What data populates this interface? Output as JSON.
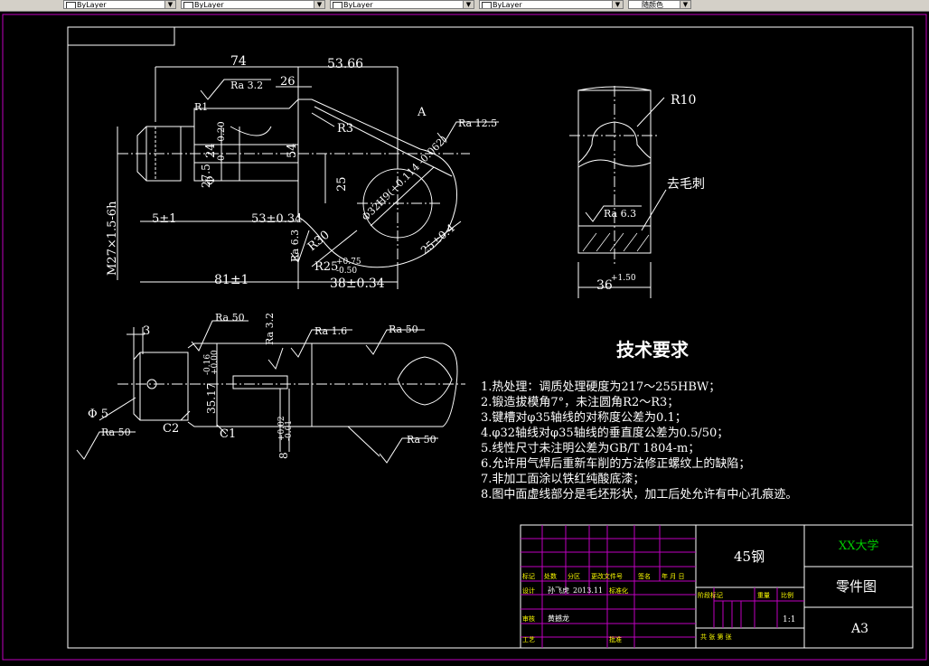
{
  "toolbar": {
    "combo1": "ByLayer",
    "combo2": "ByLayer",
    "combo3": "ByLayer",
    "combo4": "随颜色"
  },
  "top_view": {
    "dim_74": "74",
    "dim_5366": "53.66",
    "dim_26": "26",
    "ra_32": "Ra 3.2",
    "r1": "R1",
    "r3": "R3",
    "dim_24": "24",
    "dim_phi": "Φ",
    "dim_0": "0",
    "dim_020": "-0.20",
    "dim_275": "27.5",
    "dim_54": "54",
    "dim_25": "25",
    "label_a": "A",
    "ra_125": "Ra 12.5",
    "thread": "M27×1.5-6h",
    "dim_5pm1": "5±1",
    "dim_53pm034": "53±0.34",
    "r30": "R30",
    "ra_63": "Ra 6.3",
    "r25": "R25",
    "r25_tol_up": "+0.75",
    "r25_tol_dn": "-0.50",
    "dim_81pm1": "81±1",
    "dim_38pm034": "38±0.34",
    "dim_25pm04": "25±0.4",
    "hole_label": "Φ32H9(+0.114 -0.062)"
  },
  "right_view": {
    "r10": "R10",
    "deburr": "去毛刺",
    "ra_63": "Ra 6.3",
    "dim_36": "36",
    "tol": "+1.50"
  },
  "front_view": {
    "dim_3": "3",
    "ra_50a": "Ra 50",
    "ra_32": "Ra 3.2",
    "ra_16": "Ra 1.6",
    "ra_50b": "Ra 50",
    "dim_3517": "35.17",
    "tol_a": "-0.16",
    "tol_b": "+0.00",
    "dim_phi5": "Φ 5",
    "c2": "C2",
    "c1": "C1",
    "ra_50c": "Ra 50",
    "ra_50d": "Ra 50",
    "dim_8": "8",
    "tol_8a": "+0.02",
    "tol_8b": "-0.01"
  },
  "tech": {
    "title": "技术要求",
    "items": [
      "1.热处理：调质处理硬度为217～255HBW；",
      "2.锻造拔模角7°，未注圆角R2～R3；",
      "3.键槽对φ35轴线的对称度公差为0.1；",
      "4.φ32轴线对φ35轴线的垂直度公差为0.5/50；",
      "5.线性尺寸未注明公差为GB/T 1804-m；",
      "6.允许用气焊后重新车削的方法修正螺纹上的缺陷；",
      "7.非加工面涂以铁红纯酸底漆；",
      "8.图中面虚线部分是毛坯形状，加工后处允许有中心孔痕迹。"
    ]
  },
  "titleblock": {
    "material": "45钢",
    "school": "XX大学",
    "drawing_name": "零件图",
    "paper": "A3",
    "scale": "1:1",
    "row1": [
      "标记",
      "处数",
      "分区",
      "更改文件号",
      "签名",
      "年 月 日"
    ],
    "designer_label": "设计",
    "designer": "孙飞虎",
    "date": "2013.11",
    "std_label": "标准化",
    "review_label": "审核",
    "reviewer": "黄撼龙",
    "craft_label": "工艺",
    "approve_label": "批准",
    "stage_labels": "阶段标记",
    "weight_label": "重量",
    "scale_label": "比例",
    "sheet_labels": "共  张  第  张"
  }
}
